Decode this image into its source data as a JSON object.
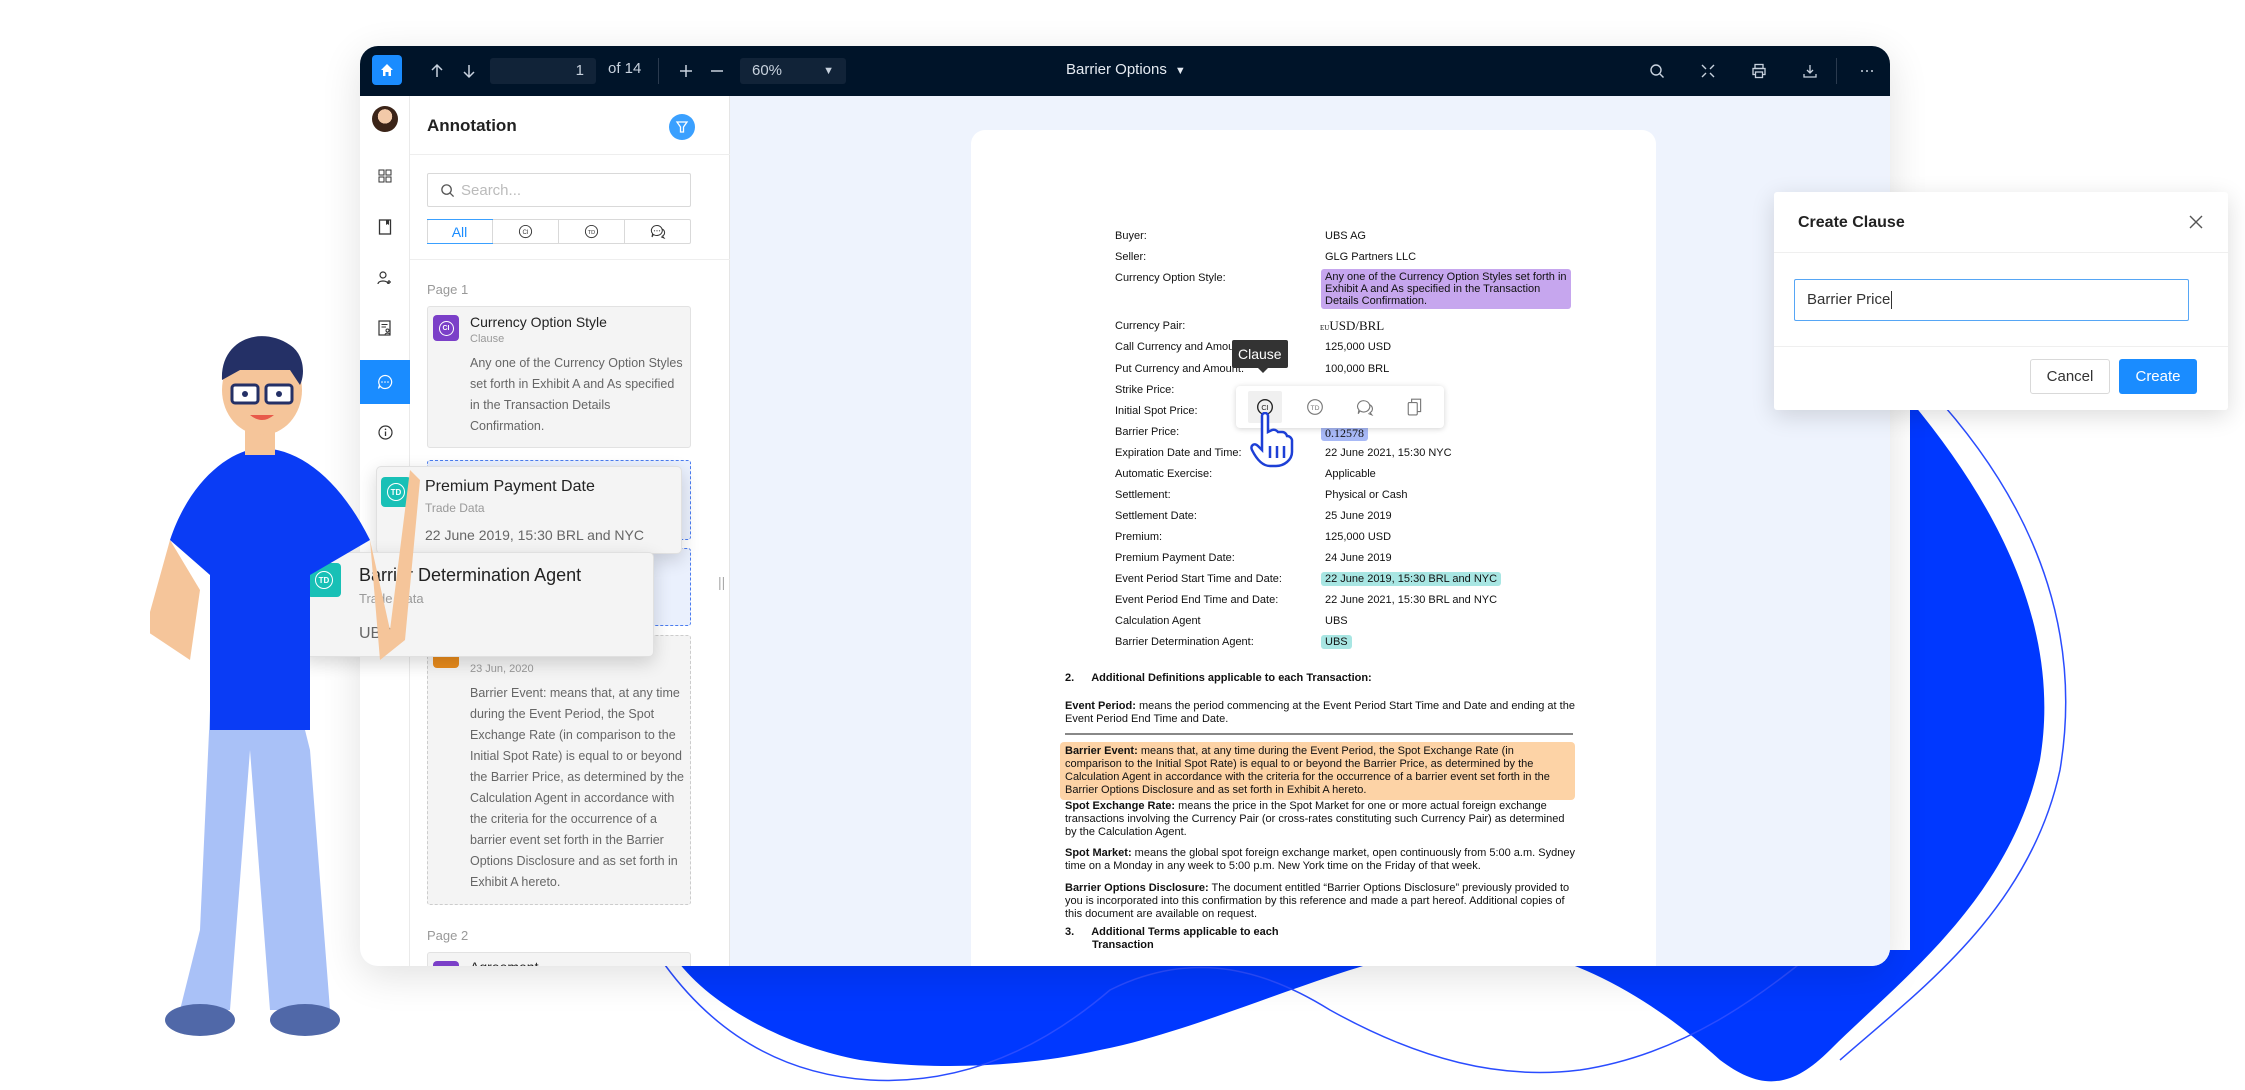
{
  "colors": {
    "brand_blue": "#1a8cff",
    "topbar_bg": "#001429",
    "clause_purple": "#7b3fc8",
    "trade_data_teal": "#18c0b6",
    "comment_orange": "#e88b1c",
    "decor_blue": "#0038ff"
  },
  "toolbar": {
    "home_icon": "home-icon",
    "page_up_icon": "arrow-up-icon",
    "page_down_icon": "arrow-down-icon",
    "current_page": "1",
    "page_total_label": "of 14",
    "zoom_in_icon": "plus-icon",
    "zoom_out_icon": "minus-icon",
    "zoom_level": "60%",
    "document_title": "Barrier Options",
    "search_icon": "search-icon",
    "fullscreen_icon": "fullscreen-icon",
    "print_icon": "print-icon",
    "download_icon": "download-icon",
    "more_icon": "more-icon"
  },
  "rail": {
    "items": [
      {
        "name": "avatar"
      },
      {
        "name": "thumbnails-icon"
      },
      {
        "name": "bookmark-icon"
      },
      {
        "name": "users-icon"
      },
      {
        "name": "document-user-icon"
      },
      {
        "name": "comments-icon",
        "active": true
      },
      {
        "name": "info-icon"
      }
    ]
  },
  "panel": {
    "title": "Annotation",
    "filter_icon": "filter-icon",
    "search_placeholder": "Search...",
    "filters": [
      {
        "label": "All",
        "active": true
      },
      {
        "label": "CI",
        "icon": "clause-icon"
      },
      {
        "label": "TD",
        "icon": "trade-data-icon"
      },
      {
        "label": "",
        "icon": "comment-icon"
      }
    ],
    "sections": [
      {
        "page_label": "Page 1",
        "cards": [
          {
            "type": "CI",
            "title": "Currency Option Style",
            "subtitle": "Clause",
            "body": "Any one of the Currency Option Styles set forth in Exhibit A and As specified in the Transaction Details Confirmation."
          },
          {
            "type": "comment",
            "title": "",
            "subtitle": "23 Jun, 2020",
            "body": "Barrier Event: means that, at any time during the Event Period, the Spot Exchange Rate (in comparison to the Initial Spot Rate) is equal to or beyond the Barrier Price, as determined by the Calculation Agent in accordance with the criteria for the occurrence of a barrier event set forth in the Barrier Options Disclosure and as set forth in Exhibit A hereto."
          }
        ]
      },
      {
        "page_label": "Page 2",
        "cards": [
          {
            "type": "CI",
            "title": "Agreement"
          }
        ]
      }
    ]
  },
  "floating_cards": [
    {
      "type": "TD",
      "title": "Premium Payment Date",
      "subtitle": "Trade Data",
      "body": "22 June 2019, 15:30 BRL and NYC"
    },
    {
      "type": "TD",
      "title": "Barrier Determination Agent",
      "subtitle": "Trade Data",
      "body": "UBS"
    }
  ],
  "document": {
    "fields": [
      {
        "key": "Buyer:",
        "value": "UBS AG"
      },
      {
        "key": "Seller:",
        "value": "GLG Partners LLC"
      },
      {
        "key": "Currency Option Style:",
        "value": "Any one of the Currency Option Styles set forth in Exhibit A and As specified in the Transaction Details Confirmation.",
        "highlight": "purple"
      },
      {
        "key": "Currency Pair:",
        "value": "USD/BRL",
        "prefix": "EU"
      },
      {
        "key": "Call Currency and Amount:",
        "value": "125,000 USD"
      },
      {
        "key": "Put Currency and Amount:",
        "value": "100,000 BRL"
      },
      {
        "key": "Strike Price:",
        "value": ""
      },
      {
        "key": "Initial Spot Price:",
        "value": ""
      },
      {
        "key": "Barrier Price:",
        "value": "0.12578",
        "highlight": "blue"
      },
      {
        "key": "Expiration Date and Time:",
        "value": "22 June 2021, 15:30 NYC"
      },
      {
        "key": "Automatic Exercise:",
        "value": "Applicable"
      },
      {
        "key": "Settlement:",
        "value": "Physical or Cash"
      },
      {
        "key": "Settlement Date:",
        "value": "25 June 2019"
      },
      {
        "key": "Premium:",
        "value": "125,000 USD"
      },
      {
        "key": "Premium Payment Date:",
        "value": "24 June 2019"
      },
      {
        "key": "Event Period Start Time and Date:",
        "value": "22 June 2019, 15:30 BRL and NYC",
        "highlight": "teal"
      },
      {
        "key": "Event Period End Time and Date:",
        "value": "22 June 2021, 15:30 BRL and NYC"
      },
      {
        "key": "Calculation Agent",
        "value": "UBS"
      },
      {
        "key": "Barrier Determination Agent:",
        "value": "UBS",
        "highlight": "teal"
      }
    ],
    "section2": {
      "num": "2.",
      "title": "Additional Definitions applicable to each Transaction:"
    },
    "paragraphs": [
      {
        "term": "Event Period:",
        "text": " means the period commencing at the Event Period Start Time and Date and ending at the Event Period End Time and Date."
      },
      {
        "term": "Barrier Event:",
        "text": " means that, at any time during the Event Period, the Spot Exchange Rate (in comparison to the Initial Spot Rate) is equal to or beyond the Barrier Price, as determined by the Calculation Agent in accordance with the criteria for the occurrence of a barrier event set forth in the Barrier Options Disclosure and as set forth in Exhibit A hereto.",
        "highlight": "orange"
      },
      {
        "term": "Spot Exchange Rate:",
        "text": " means the price in the Spot Market for one or more actual foreign exchange transactions involving the Currency Pair (or cross-rates constituting such Currency Pair) as determined by the Calculation Agent."
      },
      {
        "term": "Spot Market:",
        "text": " means the global spot foreign exchange market, open continuously from 5:00 a.m. Sydney time on a Monday in any week to 5:00 p.m. New York time on the Friday of that week."
      },
      {
        "term": "Barrier Options Disclosure:",
        "text": " The document entitled “Barrier Options Disclosure” previously provided to you is incorporated into this confirmation by this reference and made a part hereof. Additional copies of this document are available on request."
      }
    ],
    "section3": {
      "num": "3.",
      "title_line1": "Additional Terms applicable to each",
      "title_line2": "Transaction"
    }
  },
  "selection_toolbar": {
    "tooltip": "Clause",
    "buttons": [
      {
        "name": "clause-icon",
        "active": true
      },
      {
        "name": "trade-data-icon"
      },
      {
        "name": "comment-icon"
      },
      {
        "name": "copy-icon"
      }
    ]
  },
  "modal": {
    "title": "Create Clause",
    "input_value": "Barrier Price",
    "cancel_label": "Cancel",
    "create_label": "Create"
  }
}
